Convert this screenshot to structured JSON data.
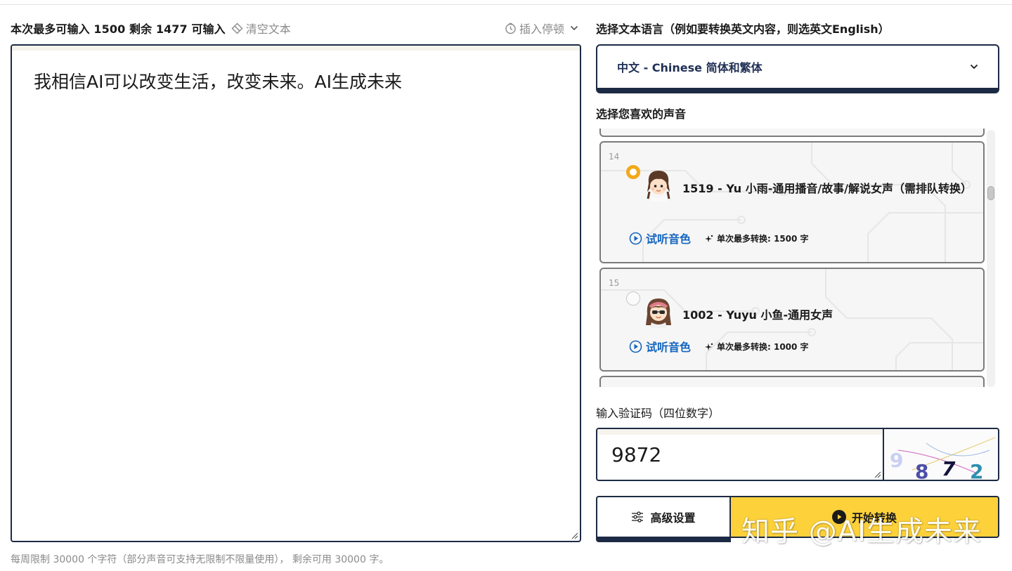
{
  "editor": {
    "counter_text": "本次最多可输入 1500 剩余 1477 可输入",
    "clear_label": "清空文本",
    "insert_pause_label": "插入停顿",
    "content": "我相信AI可以改变生活，改变未来。AI生成未来",
    "footnote": "每周限制 30000 个字符（部分声音可支持无限制不限量使用）， 剩余可用 30000 字。"
  },
  "language": {
    "label": "选择文本语言（例如要转换英文内容，则选英文English）",
    "selected": "中文 - Chinese 简体和繁体"
  },
  "voices": {
    "label": "选择您喜欢的声音",
    "items": [
      {
        "index": "14",
        "title": "1519 - Yu 小雨-通用播音/故事/解说女声（需排队转换）",
        "listen_label": "试听音色",
        "limit_text": "单次最多转换: 1500 字",
        "selected": true
      },
      {
        "index": "15",
        "title": "1002 - Yuyu 小鱼-通用女声",
        "listen_label": "试听音色",
        "limit_text": "单次最多转换: 1000 字",
        "selected": false
      }
    ]
  },
  "captcha": {
    "label": "输入验证码（四位数字）",
    "value": "9872",
    "image_digits": [
      "9",
      "8",
      "7",
      "2"
    ]
  },
  "actions": {
    "advanced_label": "高级设置",
    "start_label": "开始转换"
  },
  "watermark": "知乎 @AI生成未来",
  "colors": {
    "border_dark": "#1c2a44",
    "accent_yellow": "#fdd13a",
    "radio_selected": "#f2a91b",
    "link_blue": "#1565c0",
    "muted_text": "#8a8a8a"
  },
  "icons": {
    "clear": "eraser-icon",
    "pause": "clock-icon",
    "dropdown": "chevron-down-icon",
    "listen": "play-circle-icon",
    "limit": "sparkle-icon",
    "advanced": "sliders-icon",
    "start": "play-icon"
  }
}
